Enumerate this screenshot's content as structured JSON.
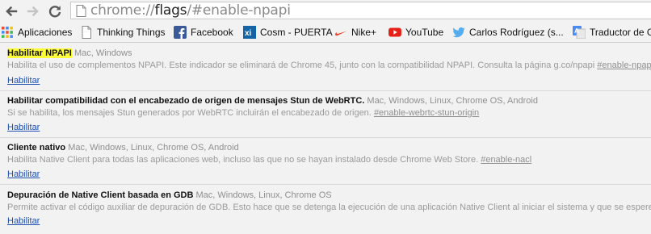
{
  "address_bar": {
    "url_scheme": "chrome://",
    "url_host": "flags",
    "url_path": "/#enable-npapi"
  },
  "bookmarks": [
    {
      "label": "Aplicaciones",
      "icon": "apps-grid-icon"
    },
    {
      "label": "Thinking Things",
      "icon": "page-icon"
    },
    {
      "label": "Facebook",
      "icon": "facebook-icon"
    },
    {
      "label": "Cosm - PUERTA",
      "icon": "xively-icon"
    },
    {
      "label": "Nike+",
      "icon": "nike-swoosh-icon"
    },
    {
      "label": "YouTube",
      "icon": "youtube-icon"
    },
    {
      "label": "Carlos Rodríguez (s...",
      "icon": "twitter-bird-icon"
    },
    {
      "label": "Traductor de G",
      "icon": "google-translate-icon"
    }
  ],
  "experiments": [
    {
      "name": "Habilitar NPAPI",
      "platforms": "Mac, Windows",
      "description": "Habilita el uso de complementos NPAPI. Este indicador se eliminará de Chrome 45, junto con la compatibilidad NPAPI. Consulta la página g.co/npapi",
      "anchor": "#enable-npapi",
      "action": "Habilitar",
      "highlighted": true
    },
    {
      "name": "Habilitar compatibilidad con el encabezado de origen de mensajes Stun de WebRTC.",
      "platforms": "Mac, Windows, Linux, Chrome OS, Android",
      "description": "Si se habilita, los mensajes Stun generados por WebRTC incluirán el encabezado de origen.",
      "anchor": "#enable-webrtc-stun-origin",
      "action": "Habilitar",
      "highlighted": false
    },
    {
      "name": "Cliente nativo",
      "platforms": "Mac, Windows, Linux, Chrome OS, Android",
      "description": "Habilita Native Client para todas las aplicaciones web, incluso las que no se hayan instalado desde Chrome Web Store.",
      "anchor": "#enable-nacl",
      "action": "Habilitar",
      "highlighted": false
    },
    {
      "name": "Depuración de Native Client basada en GDB",
      "platforms": "Mac, Windows, Linux, Chrome OS",
      "description": "Permite activar el código auxiliar de depuración de GDB. Esto hace que se detenga la ejecución de una aplicación Native Client al iniciar el sistema y que se espere a que se",
      "anchor": "",
      "action": "Habilitar",
      "highlighted": false
    }
  ],
  "colors": {
    "highlight": "#ffff3a",
    "link": "#1e4fb0",
    "youtube": "#e62117",
    "facebook": "#3b5998"
  }
}
